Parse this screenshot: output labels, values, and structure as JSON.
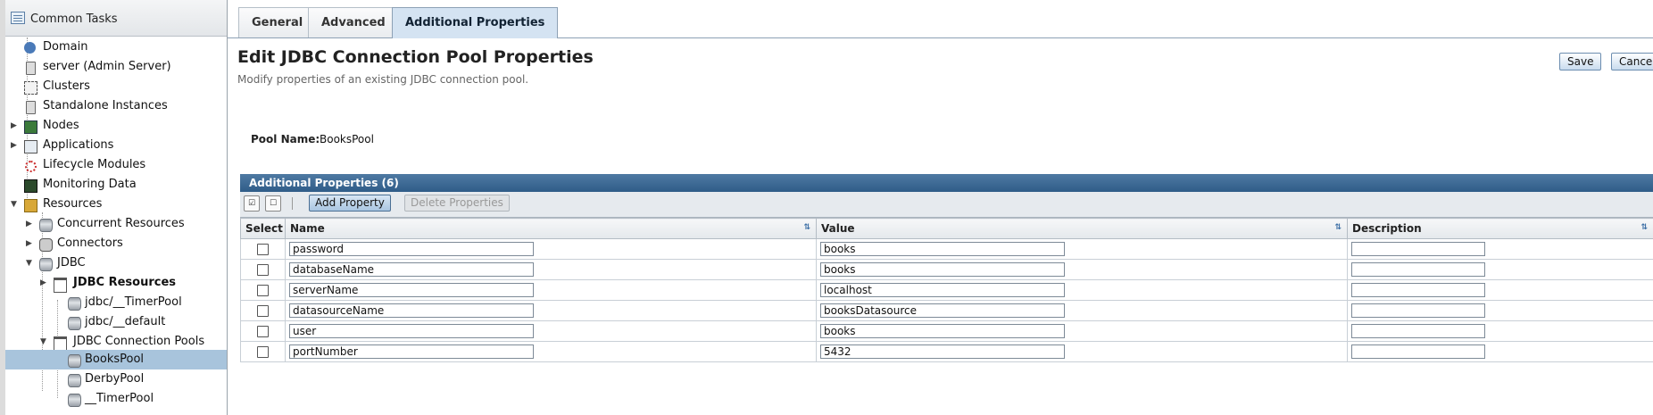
{
  "sidebar": {
    "header": "Common Tasks",
    "items": [
      {
        "label": "Domain",
        "icon": "domain-icon"
      },
      {
        "label": "server (Admin Server)",
        "icon": "server-icon"
      },
      {
        "label": "Clusters",
        "icon": "clusters-icon"
      },
      {
        "label": "Standalone Instances",
        "icon": "server-icon"
      },
      {
        "label": "Nodes",
        "icon": "nodes-icon"
      },
      {
        "label": "Applications",
        "icon": "applications-icon"
      },
      {
        "label": "Lifecycle Modules",
        "icon": "lifecycle-icon"
      },
      {
        "label": "Monitoring Data",
        "icon": "monitoring-icon"
      },
      {
        "label": "Resources",
        "icon": "resources-icon"
      },
      {
        "label": "Concurrent Resources",
        "icon": "database-icon"
      },
      {
        "label": "Connectors",
        "icon": "connector-icon"
      },
      {
        "label": "JDBC",
        "icon": "database-icon"
      },
      {
        "label": "JDBC Resources",
        "icon": "folder-icon"
      },
      {
        "label": "jdbc/__TimerPool",
        "icon": "database-icon"
      },
      {
        "label": "jdbc/__default",
        "icon": "database-icon"
      },
      {
        "label": "JDBC Connection Pools",
        "icon": "folder-icon"
      },
      {
        "label": "BooksPool",
        "icon": "database-icon"
      },
      {
        "label": "DerbyPool",
        "icon": "database-icon"
      },
      {
        "label": "__TimerPool",
        "icon": "database-icon"
      }
    ]
  },
  "tabs": [
    {
      "label": "General",
      "active": false
    },
    {
      "label": "Advanced",
      "active": false
    },
    {
      "label": "Additional Properties",
      "active": true
    }
  ],
  "page": {
    "title": "Edit JDBC Connection Pool Properties",
    "help": "Modify properties of an existing JDBC connection pool.",
    "save_label": "Save",
    "cancel_label": "Cancel",
    "pool_name_label": "Pool Name:",
    "pool_name_value": "BooksPool"
  },
  "table": {
    "title": "Additional Properties (6)",
    "add_label": "Add Property",
    "delete_label": "Delete Properties",
    "columns": [
      "Select",
      "Name",
      "Value",
      "Description"
    ],
    "rows": [
      {
        "name": "password",
        "value": "books",
        "description": ""
      },
      {
        "name": "databaseName",
        "value": "books",
        "description": ""
      },
      {
        "name": "serverName",
        "value": "localhost",
        "description": ""
      },
      {
        "name": "datasourceName",
        "value": "booksDatasource",
        "description": ""
      },
      {
        "name": "user",
        "value": "books",
        "description": ""
      },
      {
        "name": "portNumber",
        "value": "5432",
        "description": ""
      }
    ]
  },
  "colors": {
    "selected_row": "#a8c4dc",
    "table_header": "#2f5c88",
    "active_tab": "#d4e3f2"
  }
}
